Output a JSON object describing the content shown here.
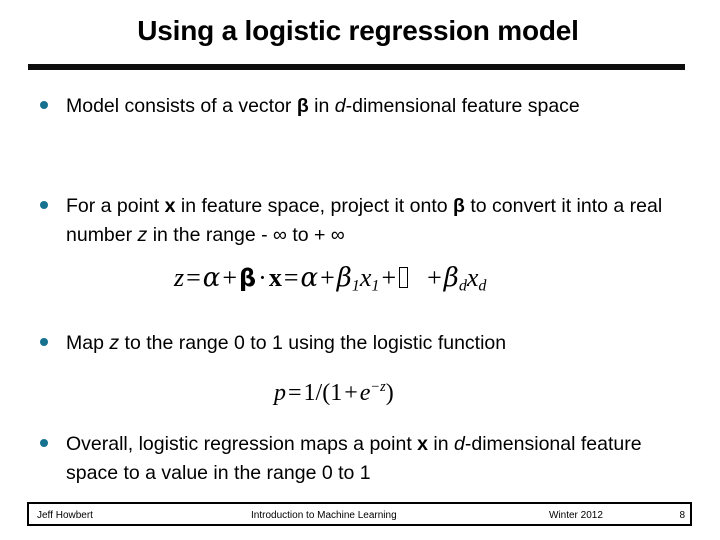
{
  "slide": {
    "title": "Using a logistic regression model",
    "accent_color": "#17728f",
    "rule_color": "#0d0d0d",
    "background": "#ffffff"
  },
  "bullets": [
    {
      "id": "bullet-1",
      "marker": "bullet-dot",
      "text_plain": "Model consists of a vector β in d-dimensional feature space",
      "segments": [
        {
          "t": "Model consists of a vector ",
          "style": "normal"
        },
        {
          "t": "β",
          "style": "bold"
        },
        {
          "t": " in ",
          "style": "normal"
        },
        {
          "t": "d",
          "style": "italic"
        },
        {
          "t": "-dimensional feature space",
          "style": "normal"
        }
      ]
    },
    {
      "id": "bullet-2",
      "marker": "bullet-dot",
      "text_plain": "For a point x in feature space, project it onto β to convert it into a real number z in the range - ∞ to + ∞",
      "segments": [
        {
          "t": "For a point ",
          "style": "normal"
        },
        {
          "t": "x",
          "style": "bold"
        },
        {
          "t": " in feature space, project it onto ",
          "style": "normal"
        },
        {
          "t": "β",
          "style": "bold"
        },
        {
          "t": " to convert it into a real number ",
          "style": "normal"
        },
        {
          "t": "z",
          "style": "italic"
        },
        {
          "t": " in the range - ∞ to + ∞",
          "style": "normal"
        }
      ]
    },
    {
      "id": "bullet-3",
      "marker": "bullet-dot",
      "text_plain": "Map z to the range 0 to 1 using the logistic function",
      "segments": [
        {
          "t": "Map ",
          "style": "normal"
        },
        {
          "t": "z",
          "style": "italic"
        },
        {
          "t": " to the range 0 to 1 using the logistic function",
          "style": "normal"
        }
      ]
    },
    {
      "id": "bullet-4",
      "marker": "bullet-dot",
      "text_plain": "Overall, logistic regression maps a point x in d-dimensional feature space to a value in the range 0 to 1",
      "segments": [
        {
          "t": "Overall, logistic regression maps a point ",
          "style": "normal"
        },
        {
          "t": "x",
          "style": "bold"
        },
        {
          "t": " in ",
          "style": "normal"
        },
        {
          "t": "d",
          "style": "italic"
        },
        {
          "t": "-dimensional feature space to a value in the range 0 to 1",
          "style": "normal"
        }
      ]
    }
  ],
  "equations": [
    {
      "id": "equation-1",
      "text_plain": "z = α + β · x = α + β₁x₁ + □ + β_d x_d",
      "note": "trailing ellipsis renders as a missing-glyph box"
    },
    {
      "id": "equation-2",
      "text_plain": "p = 1/(1 + e⁻ᶻ)"
    }
  ],
  "footer": {
    "author": "Jeff Howbert",
    "course": "Introduction to Machine Learning",
    "term": "Winter 2012",
    "page": "8"
  }
}
